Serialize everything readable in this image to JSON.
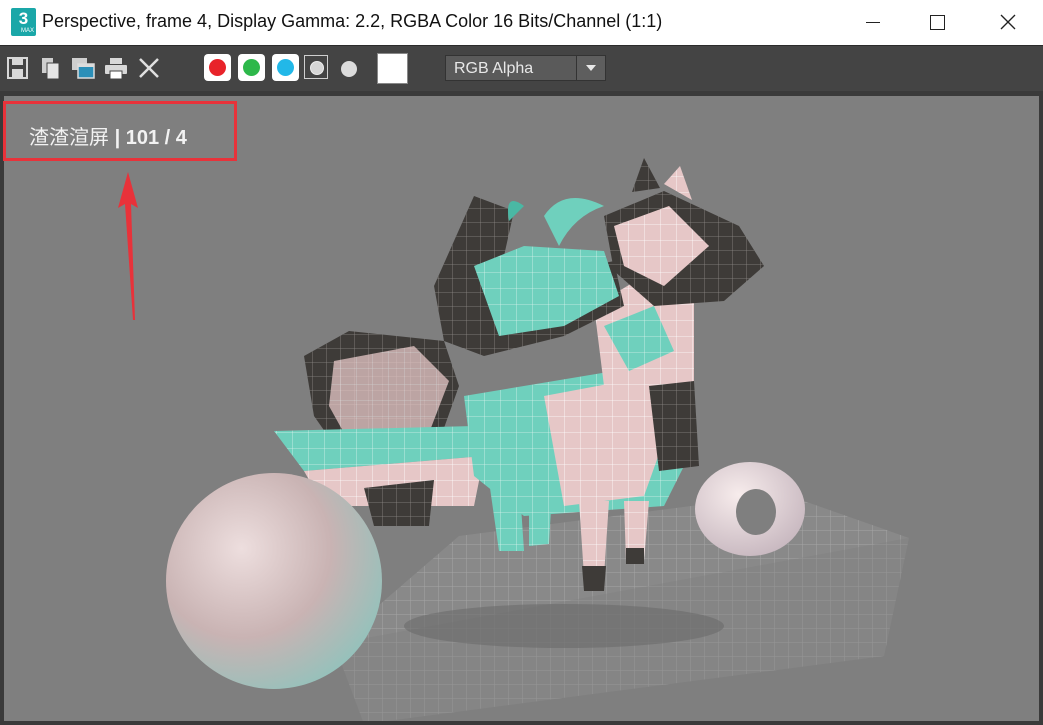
{
  "window": {
    "title": "Perspective, frame 4, Display Gamma: 2.2, RGBA Color 16 Bits/Channel (1:1)",
    "app_icon_digit": "3",
    "app_icon_sub": "MAX"
  },
  "toolbar": {
    "icons": [
      "save-icon",
      "copy-icon",
      "clone-window-icon",
      "print-icon",
      "clear-icon"
    ],
    "channels": [
      {
        "name": "red",
        "color": "#e8232a"
      },
      {
        "name": "green",
        "color": "#2db84a"
      },
      {
        "name": "blue",
        "color": "#22b8e8"
      }
    ],
    "swatch_color": "#ffffff",
    "channel_display": "RGB Alpha"
  },
  "render": {
    "stamp_prefix": "渣渣渲屏",
    "stamp_info": "| 101 / 4"
  },
  "colors": {
    "annotation": "#e8323a",
    "background": "#7f7f7f"
  }
}
